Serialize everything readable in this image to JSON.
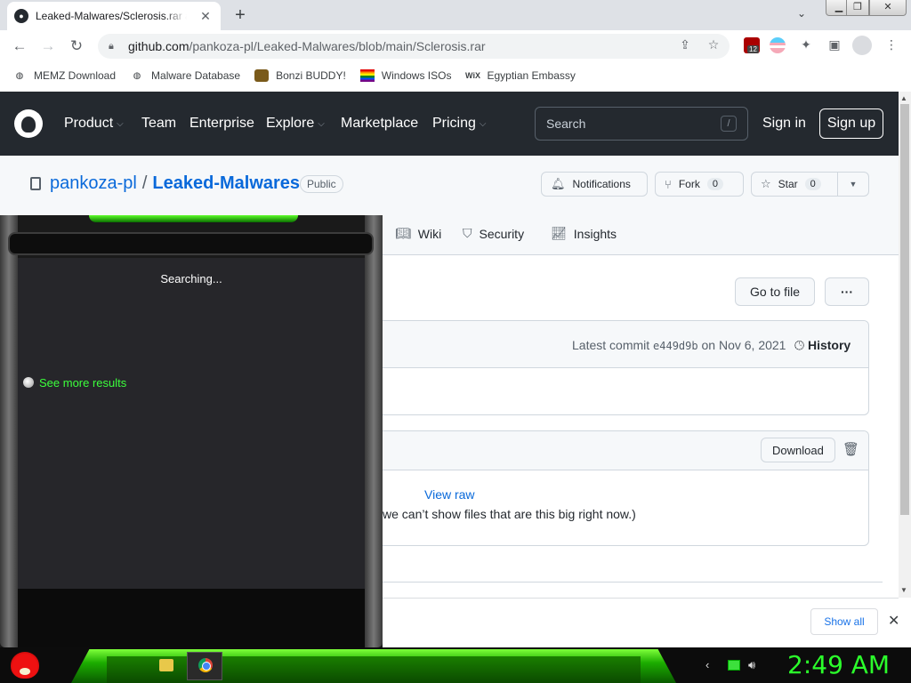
{
  "browser": {
    "tab_title": "Leaked-Malwares/Sclerosis.rar at main · pankoza-pl/Leaked-Malwares",
    "tab_close": "✕",
    "new_tab": "+",
    "url_host": "github.com",
    "url_path": "/pankoza-pl/Leaked-Malwares/blob/main/Sclerosis.rar",
    "extension_badge": "12",
    "bookmarks": [
      {
        "label": "MEMZ Download",
        "icon": "globe-icon"
      },
      {
        "label": "Malware Database",
        "icon": "globe-icon"
      },
      {
        "label": "Bonzi BUDDY!",
        "icon": "bonzi-icon"
      },
      {
        "label": "Windows ISOs",
        "icon": "windows-flag-icon"
      },
      {
        "label": "Egyptian Embassy",
        "icon": "wix-icon"
      }
    ],
    "wix_mark": "WiX"
  },
  "github": {
    "nav": [
      {
        "label": "Product"
      },
      {
        "label": "Team"
      },
      {
        "label": "Enterprise"
      },
      {
        "label": "Explore"
      },
      {
        "label": "Marketplace"
      },
      {
        "label": "Pricing"
      }
    ],
    "search_placeholder": "Search",
    "search_shortcut": "/",
    "sign_in": "Sign in",
    "sign_up": "Sign up",
    "repo_owner": "pankoza-pl",
    "repo_sep": "/",
    "repo_name": "Leaked-Malwares",
    "visibility": "Public",
    "notifications": "Notifications",
    "fork_label": "Fork",
    "fork_count": "0",
    "star_label": "Star",
    "star_count": "0",
    "tabs": [
      {
        "label": "Wiki"
      },
      {
        "label": "Security"
      },
      {
        "label": "Insights"
      }
    ],
    "go_to_file": "Go to file",
    "more": "···",
    "latest_commit_prefix": "Latest commit",
    "commit_sha": "e449d9b",
    "commit_date": "on Nov 6, 2021",
    "history": "History",
    "download": "Download",
    "view_raw": "View raw",
    "big_file_msg": "we can’t show files that are this big right now.)"
  },
  "shelf": {
    "show_all": "Show all",
    "close": "✕"
  },
  "search_panel": {
    "status": "Searching...",
    "see_more": "See more results"
  },
  "taskbar": {
    "clock": "2:49 AM"
  },
  "colors": {
    "github_header": "#24292f",
    "link_blue": "#0969da",
    "taskbar_green": "#1cad00",
    "clock_green": "#2bff2b"
  }
}
